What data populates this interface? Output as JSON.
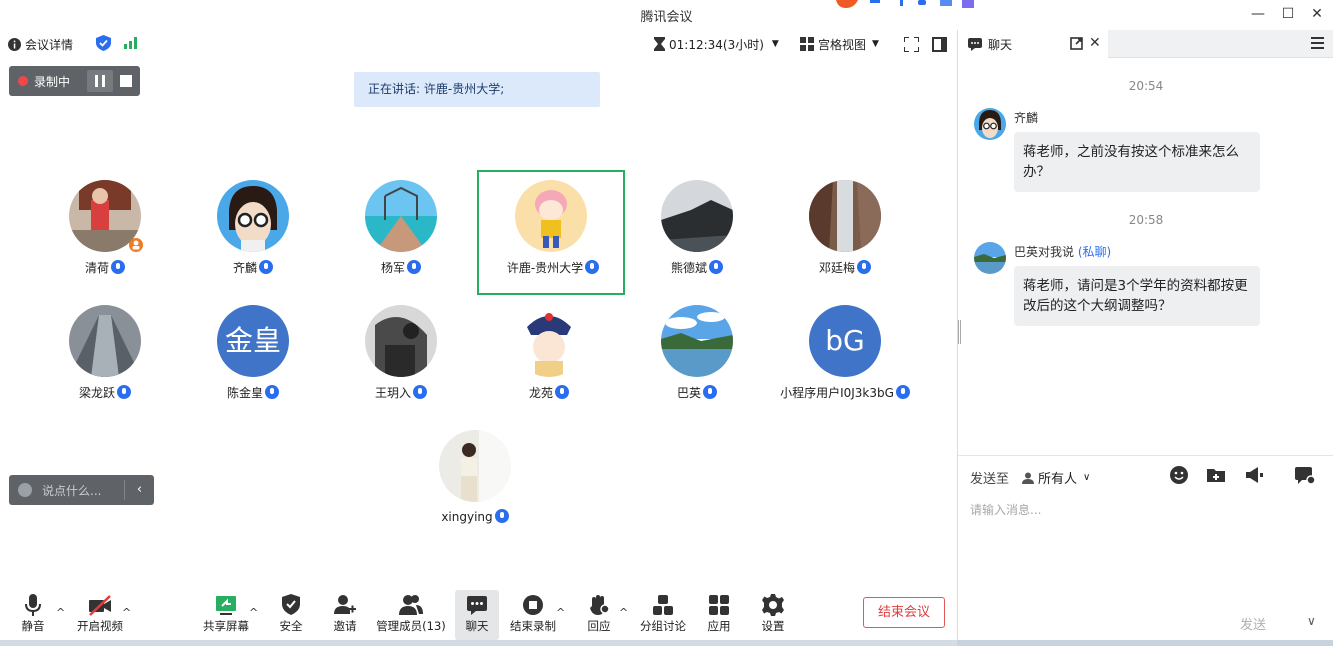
{
  "window": {
    "title": "腾讯会议"
  },
  "meeting_bar": {
    "info_label": "会议详情",
    "timer": "01:12:34(3小时)",
    "view_label": "宫格视图"
  },
  "recording": {
    "label": "录制中"
  },
  "speaking": {
    "text": "正在讲话: 许鹿-贵州大学;"
  },
  "participants": [
    {
      "name": "清荷"
    },
    {
      "name": "齐麟"
    },
    {
      "name": "杨军"
    },
    {
      "name": "许鹿-贵州大学"
    },
    {
      "name": "熊德斌"
    },
    {
      "name": "邓廷梅"
    },
    {
      "name": "梁龙跃"
    },
    {
      "name": "陈金皇",
      "avatar_text": "金皇"
    },
    {
      "name": "王玥入"
    },
    {
      "name": "龙苑"
    },
    {
      "name": "巴英"
    },
    {
      "name": "小程序用户I0J3k3bG",
      "avatar_text": "bG"
    },
    {
      "name": "xingying"
    }
  ],
  "mini_chat": {
    "placeholder": "说点什么..."
  },
  "toolbar": {
    "mute": "静音",
    "video": "开启视频",
    "share": "共享屏幕",
    "security": "安全",
    "invite": "邀请",
    "members": "管理成员(13)",
    "chat": "聊天",
    "end_record": "结束录制",
    "react": "回应",
    "breakout": "分组讨论",
    "apps": "应用",
    "settings": "设置",
    "end_meeting": "结束会议"
  },
  "chat_panel": {
    "tab_label": "聊天",
    "messages": [
      {
        "time": "20:54",
        "sender": "齐麟",
        "private": "",
        "text": "蒋老师，之前没有按这个标准来怎么办？"
      },
      {
        "time": "20:58",
        "sender": "巴英对我说",
        "private": "(私聊)",
        "text": "蒋老师，请问是3个学年的资料都按更改后的这个大纲调整吗？"
      }
    ],
    "send_to_label": "发送至",
    "recipient": "所有人",
    "input_placeholder": "请输入消息...",
    "send_label": "发送"
  },
  "colors": {
    "accent": "#2a6ef0",
    "active_border": "#27ae60",
    "end_red": "#e23c3c",
    "recording_bg": "#5f6368"
  }
}
